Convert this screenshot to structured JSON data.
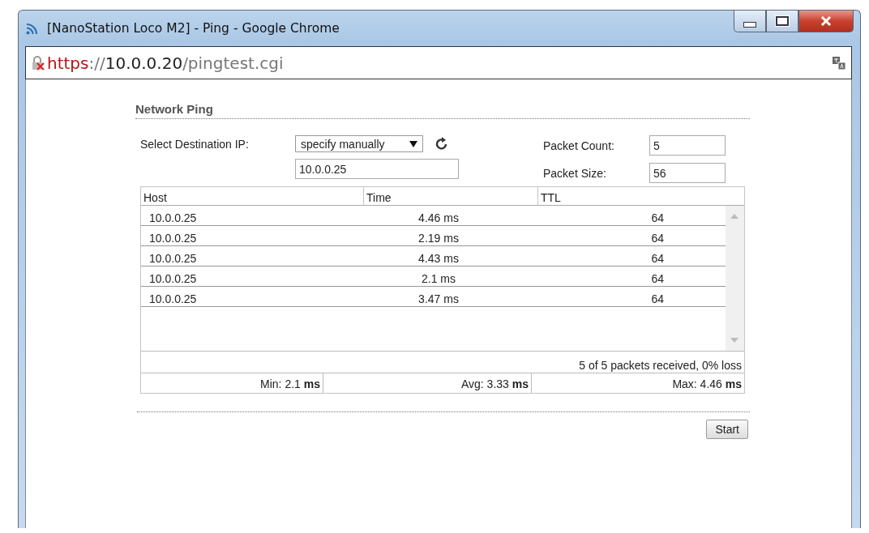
{
  "window": {
    "title": "[NanoStation Loco M2] - Ping - Google Chrome"
  },
  "address_bar": {
    "scheme": "https",
    "separator": "://",
    "host": "10.0.0.20",
    "path": "/pingtest.cgi",
    "insecure": true
  },
  "section": {
    "title": "Network Ping"
  },
  "form": {
    "destination_label": "Select Destination IP:",
    "destination_select": "specify manually",
    "destination_ip": "10.0.0.25",
    "packet_count_label": "Packet Count:",
    "packet_count": "5",
    "packet_size_label": "Packet Size:",
    "packet_size": "56"
  },
  "table": {
    "columns": [
      "Host",
      "Time",
      "TTL"
    ],
    "rows": [
      {
        "host": "10.0.0.25",
        "time": "4.46 ms",
        "ttl": "64"
      },
      {
        "host": "10.0.0.25",
        "time": "2.19 ms",
        "ttl": "64"
      },
      {
        "host": "10.0.0.25",
        "time": "4.43 ms",
        "ttl": "64"
      },
      {
        "host": "10.0.0.25",
        "time": "2.1 ms",
        "ttl": "64"
      },
      {
        "host": "10.0.0.25",
        "time": "3.47 ms",
        "ttl": "64"
      }
    ],
    "summary": "5 of 5 packets received, 0% loss",
    "stats": [
      "Min: 2.1 **ms**",
      "Avg: 3.33 **ms**",
      "Max: 4.46 **ms**"
    ]
  },
  "buttons": [
    "Start"
  ]
}
